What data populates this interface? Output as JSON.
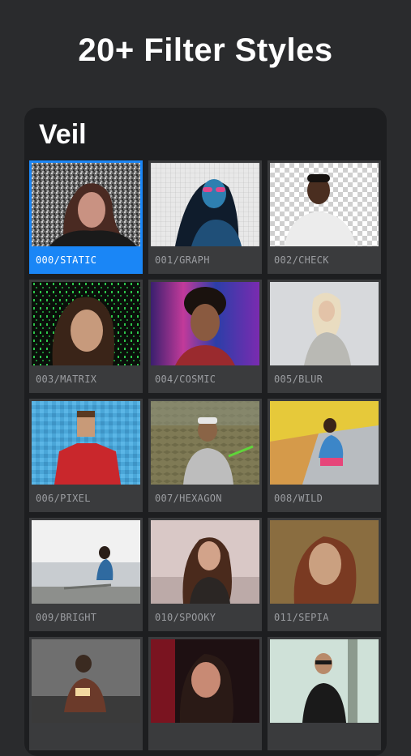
{
  "header": {
    "title": "20+ Filter Styles"
  },
  "panel": {
    "title": "Veil"
  },
  "filters": [
    {
      "label": "000/STATIC",
      "selected": true
    },
    {
      "label": "001/GRAPH"
    },
    {
      "label": "002/CHECK"
    },
    {
      "label": "003/MATRIX"
    },
    {
      "label": "004/COSMIC"
    },
    {
      "label": "005/BLUR"
    },
    {
      "label": "006/PIXEL"
    },
    {
      "label": "007/HEXAGON"
    },
    {
      "label": "008/WILD"
    },
    {
      "label": "009/BRIGHT"
    },
    {
      "label": "010/SPOOKY"
    },
    {
      "label": "011/SEPIA"
    },
    {
      "label": ""
    },
    {
      "label": ""
    },
    {
      "label": ""
    }
  ],
  "colors": {
    "accent": "#1a86f6",
    "background": "#2a2b2d",
    "panel": "#1d1e20",
    "tile": "#3a3b3d"
  }
}
